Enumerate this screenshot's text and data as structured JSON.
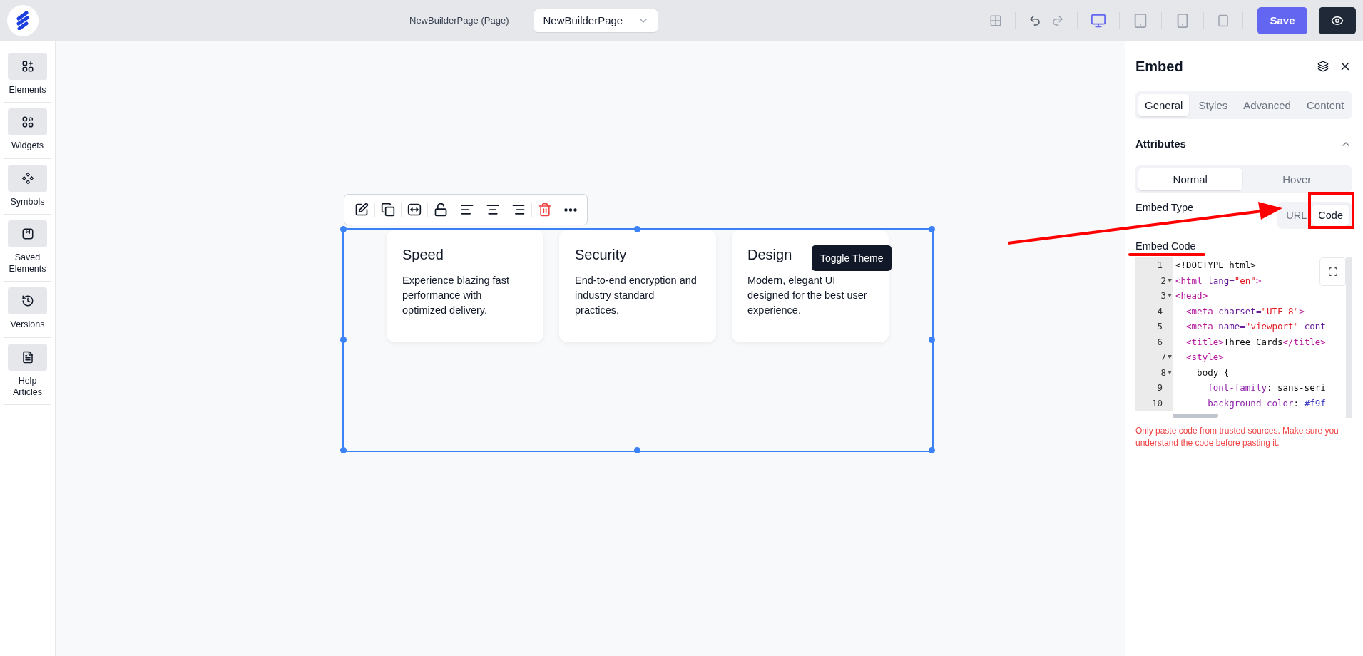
{
  "topbar": {
    "page_title": "NewBuilderPage (Page)",
    "page_select": {
      "value": "NewBuilderPage"
    },
    "tools": [
      {
        "kind": "grid",
        "disabled": true
      },
      {
        "kind": "undo",
        "disabled": false
      },
      {
        "kind": "redo",
        "disabled": true
      }
    ],
    "devices": [
      {
        "kind": "desktop",
        "selected": true
      },
      {
        "kind": "tablet",
        "selected": false
      },
      {
        "kind": "phone",
        "selected": false
      },
      {
        "kind": "small-tablet",
        "selected": false
      }
    ],
    "save": "Save"
  },
  "sidebar": {
    "items": [
      {
        "kind": "elements",
        "label": "Elements"
      },
      {
        "kind": "widgets",
        "label": "Widgets"
      },
      {
        "kind": "symbols",
        "label": "Symbols"
      },
      {
        "kind": "saved",
        "label": "Saved Elements"
      },
      {
        "kind": "versions",
        "label": "Versions"
      },
      {
        "kind": "help",
        "label": "Help Articles"
      }
    ]
  },
  "canvas": {
    "tools": [
      {
        "kind": "edit"
      },
      {
        "kind": "duplicate"
      },
      {
        "kind": "resize"
      },
      {
        "kind": "unlock"
      },
      {
        "kind": "align-left"
      },
      {
        "kind": "align-center"
      },
      {
        "kind": "align-right"
      },
      {
        "kind": "delete"
      },
      {
        "kind": "more"
      }
    ],
    "cards": [
      {
        "title": "Speed",
        "text": "Experience blazing fast performance with optimized delivery."
      },
      {
        "title": "Security",
        "text": "End-to-end encryption and industry standard practices."
      },
      {
        "title": "Design",
        "text": "Modern, elegant UI designed for the best user experience."
      }
    ],
    "tooltip": "Toggle Theme"
  },
  "panel": {
    "title": "Embed",
    "tabs": [
      {
        "label": "General",
        "selected": true
      },
      {
        "label": "Styles",
        "selected": false
      },
      {
        "label": "Advanced",
        "selected": false
      },
      {
        "label": "Content",
        "selected": false
      }
    ],
    "section": {
      "title": "Attributes",
      "expanded": true
    },
    "states": [
      {
        "label": "Normal",
        "selected": true
      },
      {
        "label": "Hover",
        "selected": false
      }
    ],
    "embed_type": {
      "label": "Embed Type",
      "options": [
        {
          "label": "URL",
          "selected": false
        },
        {
          "label": "Code",
          "selected": true
        }
      ]
    },
    "embed_code": {
      "label": "Embed Code",
      "lines": [
        {
          "number": "1",
          "foldable": false,
          "tokens": [
            {
              "kind": "plain",
              "text": "<!DOCTYPE html>"
            }
          ]
        },
        {
          "number": "2",
          "foldable": true,
          "tokens": [
            {
              "kind": "tag",
              "text": "<html "
            },
            {
              "kind": "attr",
              "text": "lang="
            },
            {
              "kind": "string",
              "text": "\"en\""
            },
            {
              "kind": "tag",
              "text": ">"
            }
          ]
        },
        {
          "number": "3",
          "foldable": true,
          "tokens": [
            {
              "kind": "tag",
              "text": "<head>"
            }
          ]
        },
        {
          "number": "4",
          "foldable": false,
          "tokens": [
            {
              "kind": "tag",
              "text": "  <meta "
            },
            {
              "kind": "attr",
              "text": "charset="
            },
            {
              "kind": "string",
              "text": "\"UTF-8\""
            },
            {
              "kind": "tag",
              "text": ">"
            }
          ]
        },
        {
          "number": "5",
          "foldable": false,
          "tokens": [
            {
              "kind": "tag",
              "text": "  <meta "
            },
            {
              "kind": "attr",
              "text": "name="
            },
            {
              "kind": "string",
              "text": "\"viewport\""
            },
            {
              "kind": "attr",
              "text": " cont"
            }
          ]
        },
        {
          "number": "6",
          "foldable": false,
          "tokens": [
            {
              "kind": "tag",
              "text": "  <title>"
            },
            {
              "kind": "plain",
              "text": "Three Cards"
            },
            {
              "kind": "tag",
              "text": "</title>"
            }
          ]
        },
        {
          "number": "7",
          "foldable": true,
          "tokens": [
            {
              "kind": "tag",
              "text": "  <style>"
            }
          ]
        },
        {
          "number": "8",
          "foldable": true,
          "tokens": [
            {
              "kind": "plain",
              "text": "    body {"
            }
          ]
        },
        {
          "number": "9",
          "foldable": false,
          "tokens": [
            {
              "kind": "prop",
              "text": "      font-family"
            },
            {
              "kind": "plain",
              "text": ": sans-seri"
            }
          ]
        },
        {
          "number": "10",
          "foldable": false,
          "tokens": [
            {
              "kind": "prop",
              "text": "      background-color"
            },
            {
              "kind": "plain",
              "text": ": "
            },
            {
              "kind": "value",
              "text": "#f9f"
            }
          ]
        }
      ]
    },
    "warning": "Only paste code from trusted sources. Make sure you understand the code before pasting it."
  }
}
